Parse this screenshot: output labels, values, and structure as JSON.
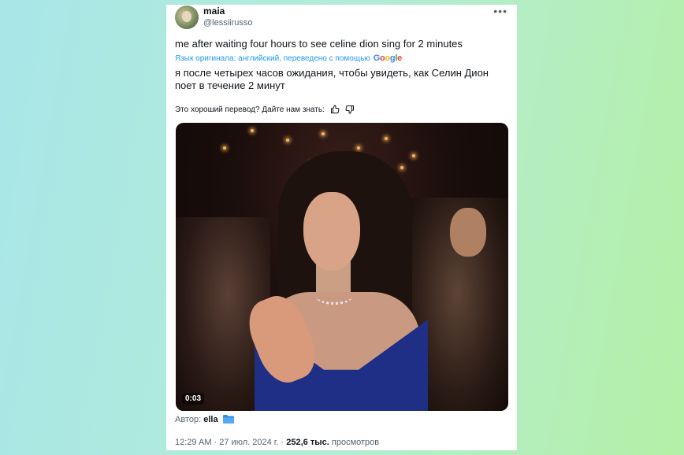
{
  "tweet": {
    "author_name": "maia",
    "author_handle": "@lessiirusso",
    "more_label": "•••",
    "text_original": "me after waiting four hours to see celine dion sing for 2 minutes",
    "translation_note": "Язык оригинала: английский, переведено с помощью",
    "translation_provider": [
      "G",
      "o",
      "o",
      "g",
      "l",
      "e"
    ],
    "text_translated": "я после четырех часов ожидания, чтобы увидеть, как Селин Дион поет в течение 2 минут",
    "feedback_prompt": "Это хороший перевод? Дайте нам знать:",
    "media": {
      "duration": "0:03"
    },
    "media_author_label": "Автор:",
    "media_author_name": "ella",
    "timestamp": "12:29 AM · 27 июл. 2024 г.",
    "separator": " · ",
    "views_count": "252,6 тыс.",
    "views_label": "просмотров"
  },
  "colors": {
    "accent": "#1d9bf0",
    "text": "#0f1419",
    "muted": "#536471"
  },
  "icons": {
    "thumb_up": "thumb-up-icon",
    "thumb_down": "thumb-down-icon",
    "folder": "folder-icon"
  }
}
